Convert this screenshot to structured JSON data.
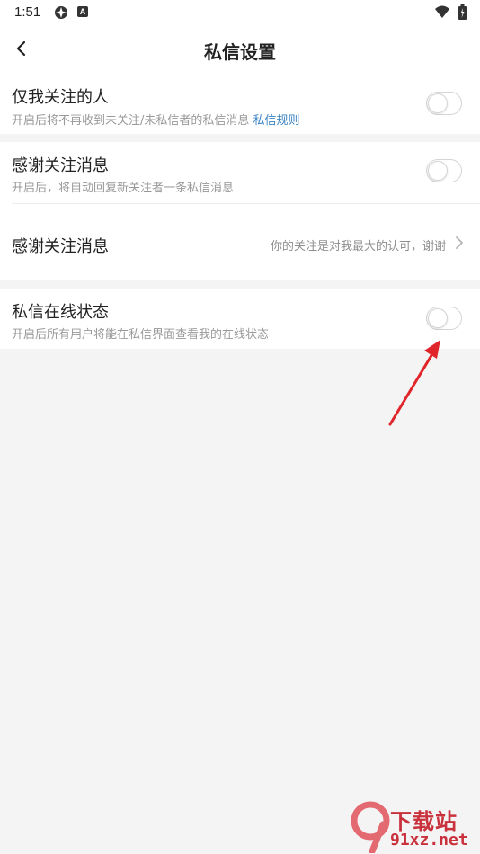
{
  "status_bar": {
    "time": "1:51",
    "icons": [
      "app-icon",
      "a-icon",
      "wifi-icon",
      "battery-icon"
    ]
  },
  "app_bar": {
    "title": "私信设置"
  },
  "settings": [
    {
      "title": "仅我关注的人",
      "desc": "开启后将不再收到未关注/未私信者的私信消息",
      "link": "私信规则",
      "toggle_on": false
    },
    {
      "title": "感谢关注消息",
      "desc": "开启后，将自动回复新关注者一条私信消息",
      "toggle_on": false
    },
    {
      "title": "感谢关注消息",
      "value": "你的关注是对我最大的认可，谢谢"
    },
    {
      "title": "私信在线状态",
      "desc": "开启后所有用户将能在私信界面查看我的在线状态",
      "toggle_on": false
    }
  ],
  "watermark": {
    "brand": "下载站",
    "url": "91xz.net"
  },
  "colors": {
    "link": "#3b84c4",
    "arrow": "#e0262a",
    "background": "#f4f4f4",
    "watermark": "#c9323c"
  }
}
